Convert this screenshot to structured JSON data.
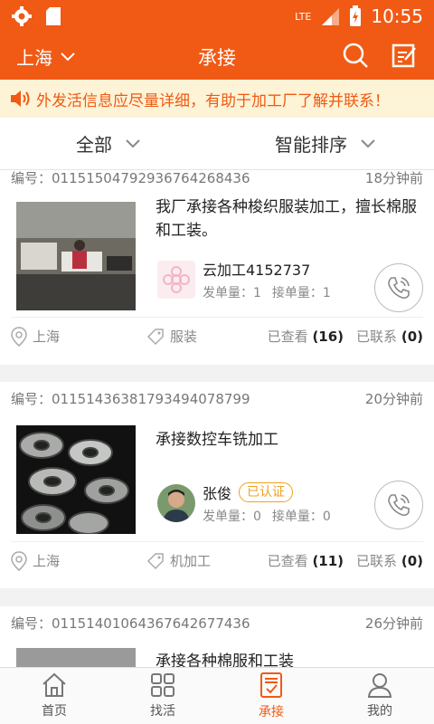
{
  "status": {
    "network": "LTE",
    "time": "10:55"
  },
  "header": {
    "city": "上海",
    "title": "承接"
  },
  "notice": "外发活信息应尽量详细，有助于加工厂了解并联系！",
  "filters": {
    "all": "全部",
    "sort": "智能排序"
  },
  "card_labels": {
    "id_prefix": "编号：",
    "order_count": "发单量：",
    "take_count": "接单量：",
    "viewed": "已查看",
    "contacted": "已联系"
  },
  "cards": [
    {
      "id": "01151504792936764268436",
      "time": "18分钟前",
      "desc": "我厂承接各种梭织服装加工，擅长棉服和工装。",
      "poster": "云加工4152737",
      "verified": "",
      "orders": "1",
      "takes": "1",
      "location": "上海",
      "category": "服装",
      "viewed": "(16)",
      "contacted": "(0)"
    },
    {
      "id": "01151436381793494078799",
      "time": "20分钟前",
      "desc": "承接数控车铣加工",
      "poster": "张俊",
      "verified": "已认证",
      "orders": "0",
      "takes": "0",
      "location": "上海",
      "category": "机加工",
      "viewed": "(11)",
      "contacted": "(0)"
    },
    {
      "id": "01151401064367642677436",
      "time": "26分钟前",
      "desc": "承接各种棉服和工装"
    }
  ],
  "tabs": [
    {
      "label": "首页",
      "icon": "home-icon"
    },
    {
      "label": "找活",
      "icon": "grid-icon"
    },
    {
      "label": "承接",
      "icon": "clipboard-icon",
      "active": true
    },
    {
      "label": "我的",
      "icon": "person-icon"
    }
  ],
  "colors": {
    "brand": "#f05a14",
    "notice_bg": "#fdf3d6",
    "verified": "#f0a020"
  }
}
